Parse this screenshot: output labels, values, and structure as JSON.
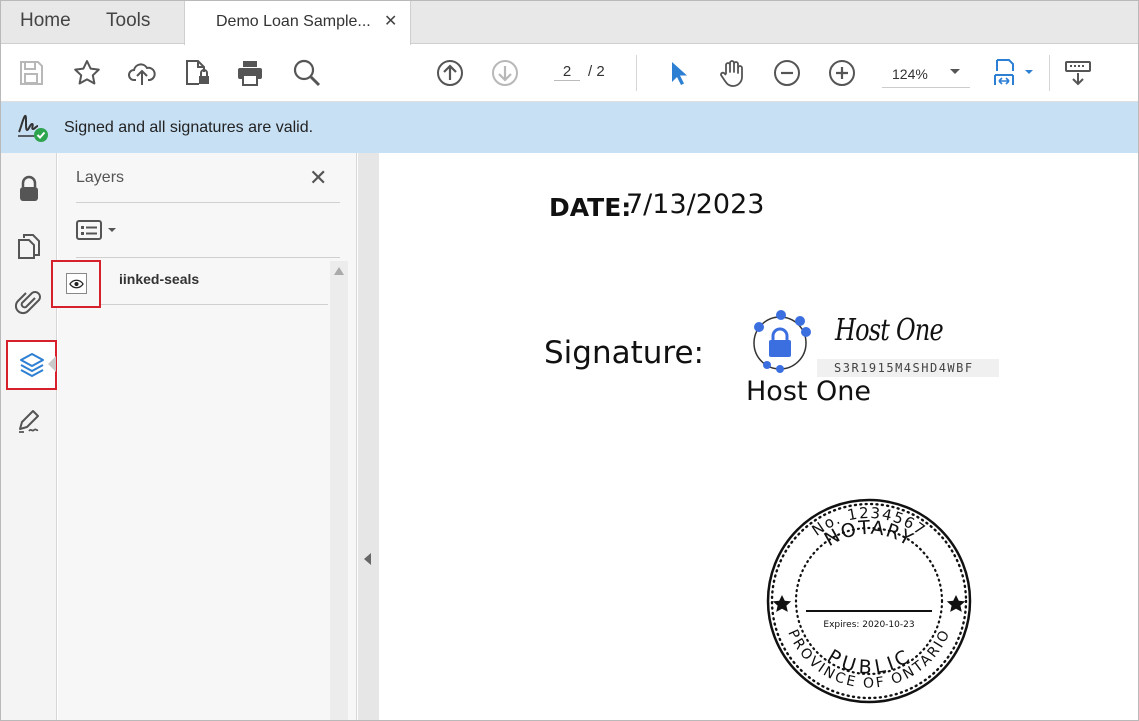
{
  "tabs": {
    "home": "Home",
    "tools": "Tools",
    "document": "Demo Loan Sample...",
    "close": "✕"
  },
  "toolbar": {
    "page_current": "2",
    "page_total": "/ 2",
    "zoom": "124%"
  },
  "banner": {
    "message": "Signed and all signatures are valid."
  },
  "layers_panel": {
    "title": "Layers",
    "close": "✕",
    "items": [
      {
        "name": "iinked-seals",
        "visible": true
      }
    ]
  },
  "document": {
    "date_label": "DATE:",
    "date_value": "7/13/2023",
    "signature_label": "Signature:",
    "signature_script": "Host One",
    "signature_code": "S3R1915M4SHD4WBF",
    "signature_printed": "Host One",
    "seal": {
      "number": "No. 1234567",
      "top_text": "NOTARY",
      "expires": "Expires: 2020-10-23",
      "middle_text": "PUBLIC",
      "bottom_text": "PROVINCE OF ONTARIO"
    }
  },
  "colors": {
    "accent_blue": "#2d7fd3",
    "banner_bg": "#c8e0f4",
    "highlight_red": "#d6202c",
    "seal_blue": "#3b6fe0"
  }
}
